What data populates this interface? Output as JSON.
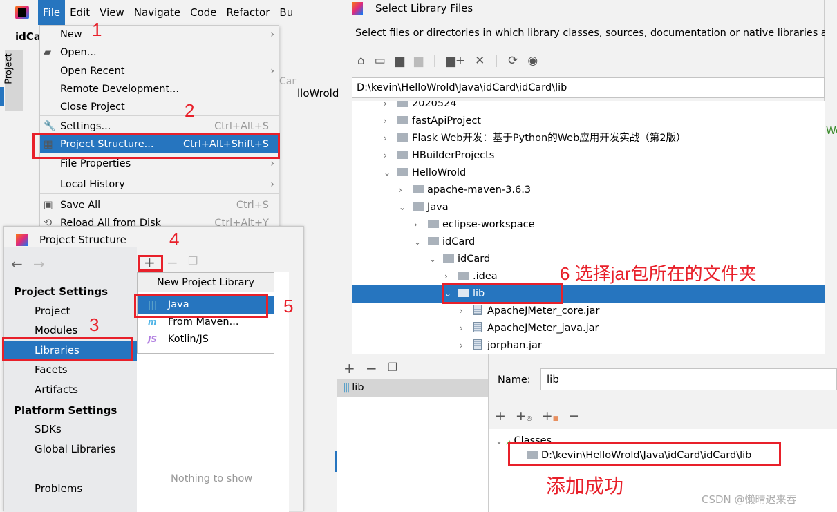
{
  "ide": {
    "menubar": [
      "File",
      "Edit",
      "View",
      "Navigate",
      "Code",
      "Refactor",
      "Bu"
    ],
    "project_tab": "idCa",
    "side_label": "Project",
    "bg_text1": "Car",
    "bg_text2": "lloWrold",
    "bg_text3": "Wo"
  },
  "file_menu": {
    "items": [
      {
        "label": "New",
        "submenu": true
      },
      {
        "label": "Open...",
        "icon": "folder-open-icon"
      },
      {
        "label": "Open Recent",
        "submenu": true
      },
      {
        "label": "Remote Development..."
      },
      {
        "label": "Close Project"
      },
      {
        "label": "Settings...",
        "shortcut": "Ctrl+Alt+S",
        "icon": "wrench-icon"
      },
      {
        "label": "Project Structure...",
        "shortcut": "Ctrl+Alt+Shift+S",
        "icon": "project-structure-icon",
        "selected": true
      },
      {
        "label": "File Properties",
        "submenu": true
      },
      {
        "label": "Local History",
        "submenu": true
      },
      {
        "label": "Save All",
        "shortcut": "Ctrl+S",
        "icon": "save-icon"
      },
      {
        "label": "Reload All from Disk",
        "shortcut": "Ctrl+Alt+Y",
        "icon": "reload-icon"
      }
    ]
  },
  "select_dialog": {
    "title": "Select Library Files",
    "description": "Select files or directories in which library classes, sources, documentation or native libraries ar",
    "path": "D:\\kevin\\HelloWrold\\Java\\idCard\\idCard\\lib",
    "tree": [
      {
        "label": "2020524",
        "level": 0,
        "open": false,
        "type": "folder"
      },
      {
        "label": "fastApiProject",
        "level": 0,
        "open": false,
        "type": "folder"
      },
      {
        "label": "Flask Web开发：基于Python的Web应用开发实战（第2版）",
        "level": 0,
        "open": false,
        "type": "folder"
      },
      {
        "label": "HBuilderProjects",
        "level": 0,
        "open": false,
        "type": "folder"
      },
      {
        "label": "HelloWrold",
        "level": 0,
        "open": true,
        "type": "folder"
      },
      {
        "label": "apache-maven-3.6.3",
        "level": 1,
        "open": false,
        "type": "folder"
      },
      {
        "label": "Java",
        "level": 1,
        "open": true,
        "type": "folder"
      },
      {
        "label": "eclipse-workspace",
        "level": 2,
        "open": false,
        "type": "folder"
      },
      {
        "label": "idCard",
        "level": 2,
        "open": true,
        "type": "folder"
      },
      {
        "label": "idCard",
        "level": 3,
        "open": true,
        "type": "folder"
      },
      {
        "label": ".idea",
        "level": 4,
        "open": false,
        "type": "folder"
      },
      {
        "label": "lib",
        "level": 4,
        "open": true,
        "type": "folder",
        "selected": true
      },
      {
        "label": "ApacheJMeter_core.jar",
        "level": 5,
        "open": false,
        "type": "jar"
      },
      {
        "label": "ApacheJMeter_java.jar",
        "level": 5,
        "open": false,
        "type": "jar"
      },
      {
        "label": "jorphan.jar",
        "level": 5,
        "open": false,
        "type": "jar"
      }
    ]
  },
  "project_structure": {
    "title": "Project Structure",
    "sidebar": [
      {
        "label": "Project Settings",
        "header": true
      },
      {
        "label": "Project"
      },
      {
        "label": "Modules"
      },
      {
        "label": "Libraries",
        "selected": true
      },
      {
        "label": "Facets"
      },
      {
        "label": "Artifacts"
      },
      {
        "label": "Platform Settings",
        "header": true
      },
      {
        "label": "SDKs"
      },
      {
        "label": "Global Libraries"
      },
      {
        "label": "Problems"
      }
    ],
    "popup": {
      "title": "New Project Library",
      "items": [
        {
          "label": "Java",
          "selected": true
        },
        {
          "label": "From Maven..."
        },
        {
          "label": "Kotlin/JS"
        }
      ]
    },
    "empty_text": "Nothing to show"
  },
  "library_panel": {
    "list": [
      "lib"
    ],
    "name_label": "Name:",
    "name_value": "lib",
    "classes_label": "Classes",
    "class_path": "D:\\kevin\\HelloWrold\\Java\\idCard\\idCard\\lib"
  },
  "annotations": {
    "n1": "1",
    "n2": "2",
    "n3": "3",
    "n4": "4",
    "n5": "5",
    "n6": "6 选择jar包所在的文件夹",
    "success": "添加成功"
  },
  "watermark": "CSDN @懒晴迟来吞",
  "colors": {
    "selection": "#2675bf",
    "annotation": "#e8202a"
  }
}
